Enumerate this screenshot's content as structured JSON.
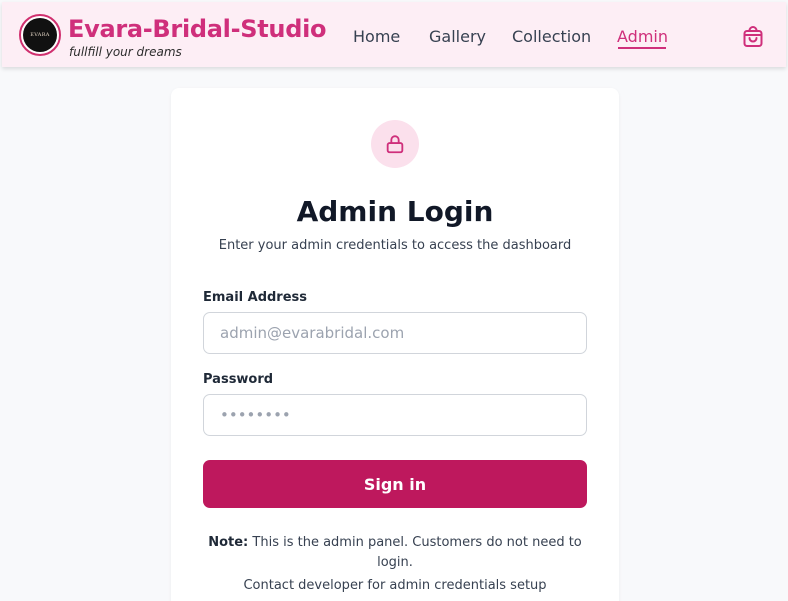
{
  "header": {
    "brand_title": "Evara-Bridal-Studio",
    "tagline": "fullfill your dreams",
    "logo_text": "EVARA",
    "nav": [
      {
        "label": "Home",
        "active": false
      },
      {
        "label": "Gallery",
        "active": false
      },
      {
        "label": "Collection",
        "active": false
      },
      {
        "label": "Admin",
        "active": true
      }
    ],
    "cart_icon": "shopping-bag-icon"
  },
  "login": {
    "icon": "lock-icon",
    "title": "Admin Login",
    "subtitle": "Enter your admin credentials to access the dashboard",
    "email_label": "Email Address",
    "email_placeholder": "admin@evarabridal.com",
    "password_label": "Password",
    "password_placeholder": "••••••••",
    "signin_label": "Sign in",
    "note_bold": "Note:",
    "note_text": " This is the admin panel. Customers do not need to login.",
    "contact_text": "Contact developer for admin credentials setup"
  },
  "colors": {
    "brand": "#cf2f7b",
    "button": "#be185d",
    "header_bg": "#fdeef5",
    "lock_bg": "#fbe0ec"
  }
}
